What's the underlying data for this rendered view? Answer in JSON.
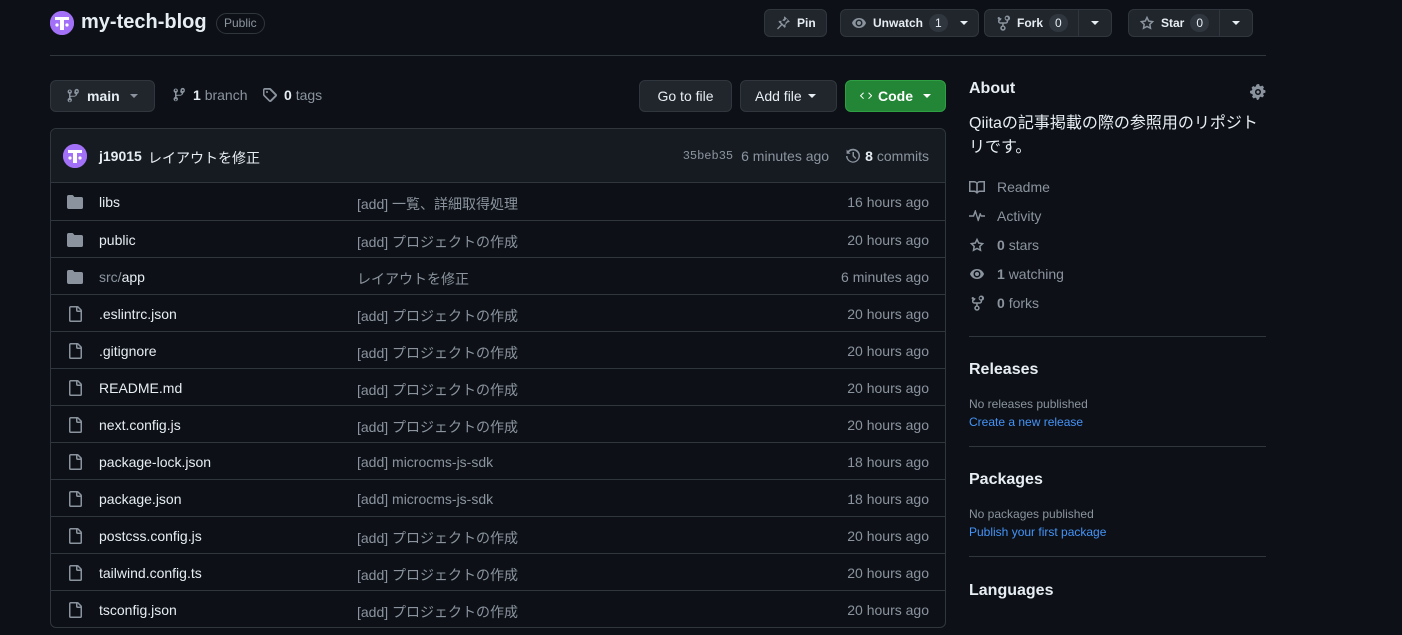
{
  "repo": {
    "name": "my-tech-blog",
    "visibility": "Public"
  },
  "actions": {
    "pin": "Pin",
    "unwatch": "Unwatch",
    "unwatch_count": "1",
    "fork": "Fork",
    "fork_count": "0",
    "star": "Star",
    "star_count": "0"
  },
  "branch_bar": {
    "branch": "main",
    "branch_count": "1",
    "branch_word": "branch",
    "tag_count": "0",
    "tag_word": "tags",
    "go_to_file": "Go to file",
    "add_file": "Add file",
    "code": "Code"
  },
  "commit": {
    "author": "j19015",
    "message": "レイアウトを修正",
    "sha": "35beb35",
    "time": "6 minutes ago",
    "count": "8",
    "count_word": "commits"
  },
  "files": [
    {
      "type": "dir",
      "prefix": "",
      "name": "libs",
      "message": "[add] 一覧、詳細取得処理",
      "age": "16 hours ago"
    },
    {
      "type": "dir",
      "prefix": "",
      "name": "public",
      "message": "[add] プロジェクトの作成",
      "age": "20 hours ago"
    },
    {
      "type": "dir",
      "prefix": "src/",
      "name": "app",
      "message": "レイアウトを修正",
      "age": "6 minutes ago"
    },
    {
      "type": "file",
      "prefix": "",
      "name": ".eslintrc.json",
      "message": "[add] プロジェクトの作成",
      "age": "20 hours ago"
    },
    {
      "type": "file",
      "prefix": "",
      "name": ".gitignore",
      "message": "[add] プロジェクトの作成",
      "age": "20 hours ago"
    },
    {
      "type": "file",
      "prefix": "",
      "name": "README.md",
      "message": "[add] プロジェクトの作成",
      "age": "20 hours ago"
    },
    {
      "type": "file",
      "prefix": "",
      "name": "next.config.js",
      "message": "[add] プロジェクトの作成",
      "age": "20 hours ago"
    },
    {
      "type": "file",
      "prefix": "",
      "name": "package-lock.json",
      "message": "[add] microcms-js-sdk",
      "age": "18 hours ago"
    },
    {
      "type": "file",
      "prefix": "",
      "name": "package.json",
      "message": "[add] microcms-js-sdk",
      "age": "18 hours ago"
    },
    {
      "type": "file",
      "prefix": "",
      "name": "postcss.config.js",
      "message": "[add] プロジェクトの作成",
      "age": "20 hours ago"
    },
    {
      "type": "file",
      "prefix": "",
      "name": "tailwind.config.ts",
      "message": "[add] プロジェクトの作成",
      "age": "20 hours ago"
    },
    {
      "type": "file",
      "prefix": "",
      "name": "tsconfig.json",
      "message": "[add] プロジェクトの作成",
      "age": "20 hours ago"
    }
  ],
  "about": {
    "title": "About",
    "description": "Qiitaの記事掲載の際の参照用のリポジトリです。",
    "readme": "Readme",
    "activity": "Activity",
    "stars_count": "0",
    "stars_word": "stars",
    "watching_count": "1",
    "watching_word": "watching",
    "forks_count": "0",
    "forks_word": "forks"
  },
  "releases": {
    "title": "Releases",
    "none": "No releases published",
    "create_link": "Create a new release"
  },
  "packages": {
    "title": "Packages",
    "none": "No packages published",
    "publish_link": "Publish your first package"
  },
  "languages": {
    "title": "Languages"
  },
  "colors": {
    "background": "#0d1117",
    "border": "#30363d",
    "accent_link": "#4493f8",
    "code_button": "#238636",
    "avatar": "#a371f7"
  }
}
